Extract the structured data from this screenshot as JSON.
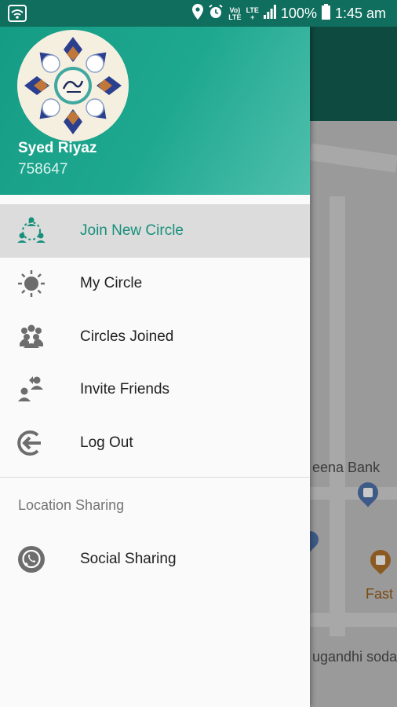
{
  "status_bar": {
    "network_small_top": "Vo)",
    "network_small_bottom": "LTE",
    "lte_top": "LTE",
    "lte_bottom": "+",
    "battery": "100%",
    "time": "1:45 am"
  },
  "drawer": {
    "user_name": "Syed Riyaz",
    "user_id": "758647",
    "menu_items": [
      {
        "label": "Join New Circle",
        "icon": "join-circle-icon",
        "active": true
      },
      {
        "label": "My Circle",
        "icon": "sun-circle-icon",
        "active": false
      },
      {
        "label": "Circles Joined",
        "icon": "group-icon",
        "active": false
      },
      {
        "label": "Invite Friends",
        "icon": "invite-icon",
        "active": false
      },
      {
        "label": "Log Out",
        "icon": "logout-icon",
        "active": false
      }
    ],
    "section_title": "Location Sharing",
    "social_item": {
      "label": "Social Sharing",
      "icon": "whatsapp-icon"
    }
  },
  "map": {
    "labels": [
      "eena Bank",
      "Fast",
      "ugandhi soda"
    ]
  },
  "colors": {
    "accent": "#17907b",
    "header_start": "#149b83",
    "header_end": "#4fc0ad",
    "status_bar": "#0f6e5e",
    "active_row": "#dcdcdc"
  }
}
